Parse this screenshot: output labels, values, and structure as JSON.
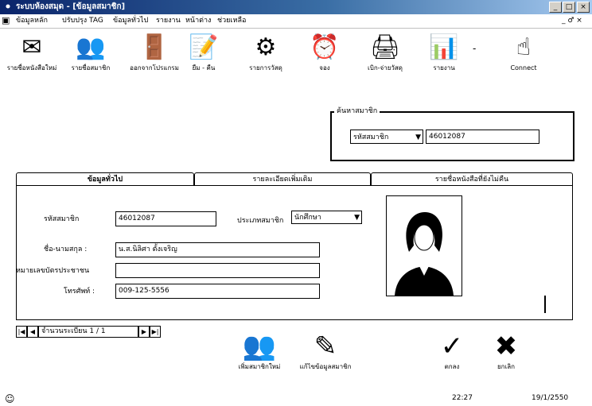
{
  "window": {
    "title": "ระบบห้องสมุด - [ข้อมูลสมาชิก]",
    "app_icon": "app-icon",
    "controls": [
      "_",
      "□",
      "×"
    ]
  },
  "menu": [
    "ข้อมูลหลัก",
    "ปรับปรุง TAG",
    "ข้อมูลทั่วไป",
    "รายงาน",
    "หน้าต่าง",
    "ช่วยเหลือ"
  ],
  "menu_right": "_ ♂ ×",
  "toolbar": [
    {
      "label": "รายชื่อหนังสือใหม่",
      "icon": "book-open-icon",
      "glyph": "✉"
    },
    {
      "label": "รายชื่อสมาชิก",
      "icon": "members-icon",
      "glyph": "👥"
    },
    {
      "label": "ออกจากโปรแกรม",
      "icon": "exit-door-icon",
      "glyph": "🚪"
    },
    {
      "label": "ยืม - คืน",
      "icon": "borrow-return-icon",
      "glyph": "📝"
    },
    {
      "label": "รายการวัสดุ",
      "icon": "materials-icon",
      "glyph": "⚙"
    },
    {
      "label": "จอง",
      "icon": "reserve-clock-icon",
      "glyph": "⏰"
    },
    {
      "label": "เบิก-จ่ายวัสดุ",
      "icon": "printer-icon",
      "glyph": "🖨"
    },
    {
      "label": "รายงาน",
      "icon": "report-icon",
      "glyph": "📊"
    },
    {
      "label": "Connect",
      "icon": "connect-hand-icon",
      "glyph": "☝"
    }
  ],
  "toolbar_separator": "-",
  "search": {
    "legend": "ค้นหาสมาชิก",
    "field_select": "รหัสสมาชิก",
    "value": "46012087"
  },
  "tabs": [
    "ข้อมูลทั่วไป",
    "รายละเอียดเพิ่มเติม",
    "รายชื่อหนังสือที่ยังไม่คืน"
  ],
  "form": {
    "member_id_label": "รหัสสมาชิก",
    "member_id": "46012087",
    "member_type_label": "ประเภทสมาชิก",
    "member_type": "นักศึกษา",
    "name_label": "ชื่อ-นามสกุล :",
    "name": "น.ส.นิลิศา ตั้งเจริญ",
    "id_card_label": "หมายเลขบัตรประชาชน",
    "id_card": "",
    "phone_label": "โทรศัพท์ :",
    "phone": "009-125-5556"
  },
  "record_nav": {
    "text": "จำนวนระเบียน 1 / 1",
    "first": "|◀",
    "prev": "◀",
    "next": "▶",
    "last": "▶|"
  },
  "bottom_actions": [
    {
      "label": "เพิ่มสมาชิกใหม่",
      "icon": "add-member-icon",
      "glyph": "👥"
    },
    {
      "label": "แก้ไขข้อมูลสมาชิก",
      "icon": "edit-member-icon",
      "glyph": "✎"
    },
    {
      "label": "ตกลง",
      "icon": "ok-icon",
      "glyph": "✓"
    },
    {
      "label": "ยกเลิก",
      "icon": "cancel-icon",
      "glyph": "✖"
    }
  ],
  "status": {
    "time": "22:27",
    "date": "19/1/2550"
  }
}
